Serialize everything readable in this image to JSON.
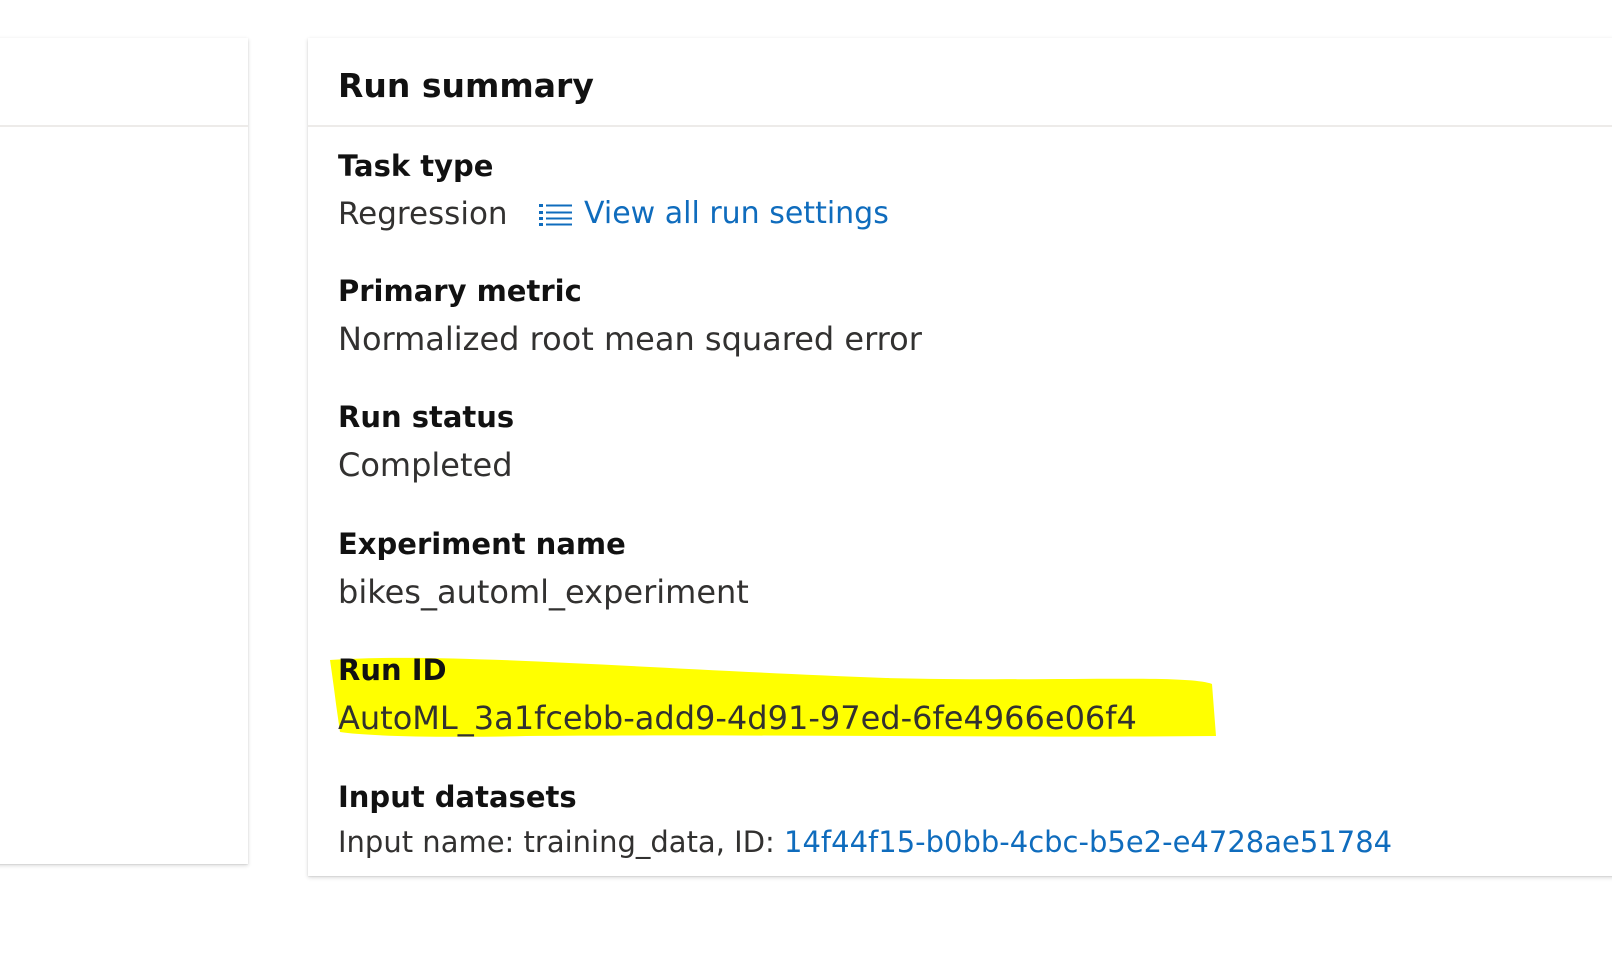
{
  "run_summary": {
    "title": "Run summary",
    "task_type": {
      "label": "Task type",
      "value": "Regression",
      "settings_link": "View all run settings",
      "settings_icon": "list-icon"
    },
    "primary_metric": {
      "label": "Primary metric",
      "value": "Normalized root mean squared error"
    },
    "run_status": {
      "label": "Run status",
      "value": "Completed"
    },
    "experiment_name": {
      "label": "Experiment name",
      "value": "bikes_automl_experiment"
    },
    "run_id": {
      "label": "Run ID",
      "value": "AutoML_3a1fcebb-add9-4d91-97ed-6fe4966e06f4"
    },
    "input_datasets": {
      "label": "Input datasets",
      "prefix": "Input name: training_data, ID:",
      "dataset_id": "14f44f15-b0bb-4cbc-b5e2-e4728ae51784"
    }
  },
  "colors": {
    "link": "#0f6cbd",
    "highlight": "#ffff00",
    "divider": "#edebe9"
  }
}
